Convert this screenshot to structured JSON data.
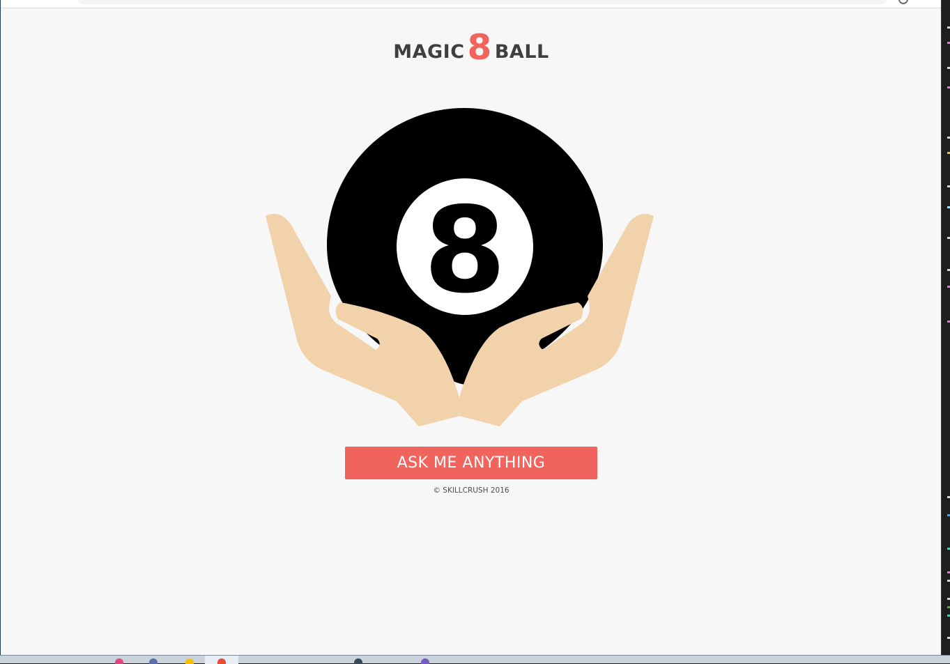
{
  "app": {
    "title_left": "MAGIC",
    "title_number": "8",
    "title_right": "BALL",
    "ball_number": "8",
    "button_label": "ASK ME ANYTHING",
    "footer": "© SKILLCRUSH 2016"
  },
  "colors": {
    "accent": "#f1645d",
    "title_text": "#3f3f3f",
    "background": "#f7f7f7",
    "ball": "#000000",
    "skin": "#f2d2aa"
  },
  "taskbar": {
    "icons": [
      "pinned-app-icon",
      "pinned-app-icon",
      "pinned-app-icon",
      "chrome-icon",
      "pinned-app-icon",
      "pinned-app-icon"
    ]
  }
}
